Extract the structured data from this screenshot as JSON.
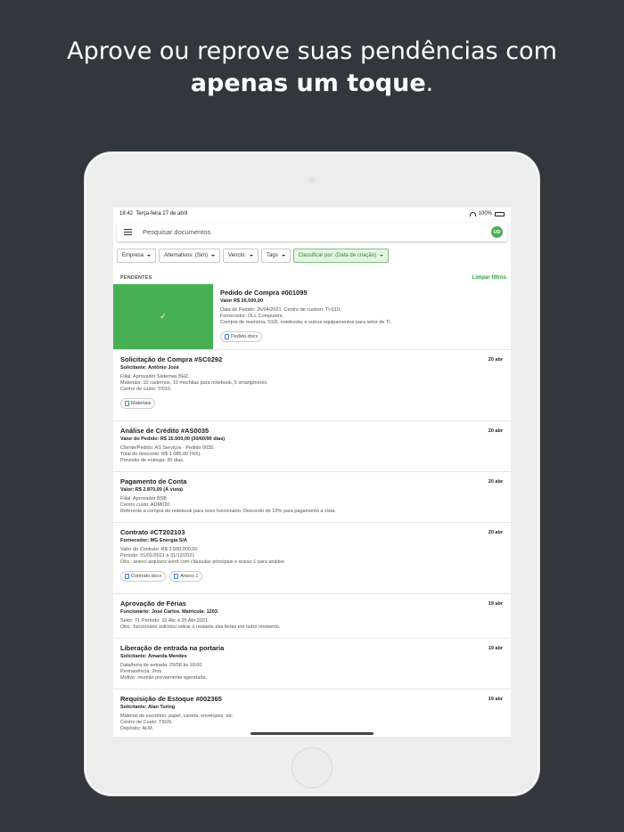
{
  "headline": {
    "line1": "Aprove ou reprove suas pendências com",
    "line2_bold": "apenas um toque",
    "line2_end": "."
  },
  "status": {
    "time": "18:42",
    "date": "Terça-feira 27 de abril",
    "battery": "100%"
  },
  "search": {
    "placeholder": "Pesquisar documentos",
    "avatar": "UD"
  },
  "filters": [
    {
      "label": "Empresa"
    },
    {
      "label": "Alternativos: (Sim)"
    },
    {
      "label": "Vencto:"
    },
    {
      "label": "Tags"
    },
    {
      "label": "Classificar por: (Data de criação)"
    }
  ],
  "section": {
    "title": "PENDENTES",
    "clear": "Limpar filtros"
  },
  "swiped": {
    "title": "Pedido de Compra #001095",
    "subtitle": "Valor R$ 26.500,00",
    "lines": [
      "Data do Pedido: 26/04/2021. Centro de custom: TI-010.",
      "Fornecedor: DLL Computers.",
      "Compra de memória, SSD, notebooks e outros equipamentos para setor de TI."
    ],
    "attachment": "Pedido.docx",
    "action_icon": "check-icon"
  },
  "docs": [
    {
      "title": "Solicitação de Compra #SC0292",
      "subtitle": "Solicitante: Antônio José",
      "date": "20 abr",
      "lines": [
        "Filial: Aprovador Sistemas BHZ.",
        "Materiais: 10 cadernos, 10 mochilas para notebook, 5 smartphones.",
        "Centro de custo: TI010."
      ],
      "attachments": [
        "Materiais"
      ]
    },
    {
      "title": "Análise de Crédito #AS0035",
      "subtitle": "Valor do Pedido: R$ 15.500,00 (30/60/90 dias)",
      "date": "20 abr",
      "lines": [
        "Cliente/Pedido: AS Serviços - Pedido 0035.",
        "Total do desconto: R$ 1.085,00 (%5).",
        "Previsão de entrega: 30 dias."
      ],
      "attachments": []
    },
    {
      "title": "Pagamento de Conta",
      "subtitle": "Valor: R$ 2.870,00 (À vista)",
      "date": "20 abr",
      "lines": [
        "Filial: Aprovador BSB",
        "Centro custo: ADM020",
        "Referente a compra de notebook para novo funcionário. Desconto de 10% para pagamento a vista."
      ],
      "attachments": []
    },
    {
      "title": "Contrato #CT202103",
      "subtitle": "Fornecedor: MG Energia S/A",
      "date": "20 abr",
      "lines": [
        "Valor do Contrato: R$ 3.500.000,00",
        "Período: 01/01/2021 à 31/12/2021",
        "Obs.: anexo arquivos word com cláusulas principais e anexo 1 para análise."
      ],
      "attachments": [
        "Contrato.docx",
        "Anexo 1"
      ]
    },
    {
      "title": "Aprovação de Férias",
      "subtitle": "Funcionário: José Carlos. Matrícula: 1203.",
      "date": "19 abr",
      "lines": [
        "Setor: TI. Período: 10 Abr à 25 Abr 2021.",
        "Obs.: funcionário solicitou retirar o restante das férias em outro momento."
      ],
      "attachments": []
    },
    {
      "title": "Liberação de entrada na portaria",
      "subtitle": "Solicitante: Amanda Mendes",
      "date": "19 abr",
      "lines": [
        "Data/hora de entrada: 29/08 às 18:00",
        "Permanência: 2hrs",
        "Motivo: reunião previamente agendada."
      ],
      "attachments": []
    },
    {
      "title": "Requisição de Estoque #002365",
      "subtitle": "Solicitante: Alan Turing",
      "date": "19 abr",
      "lines": [
        "Material de escritório: papel, caneta, envelopes, etc.",
        "Centro de Custo: TI020.",
        "Depósito: ALM."
      ],
      "attachments": []
    }
  ]
}
